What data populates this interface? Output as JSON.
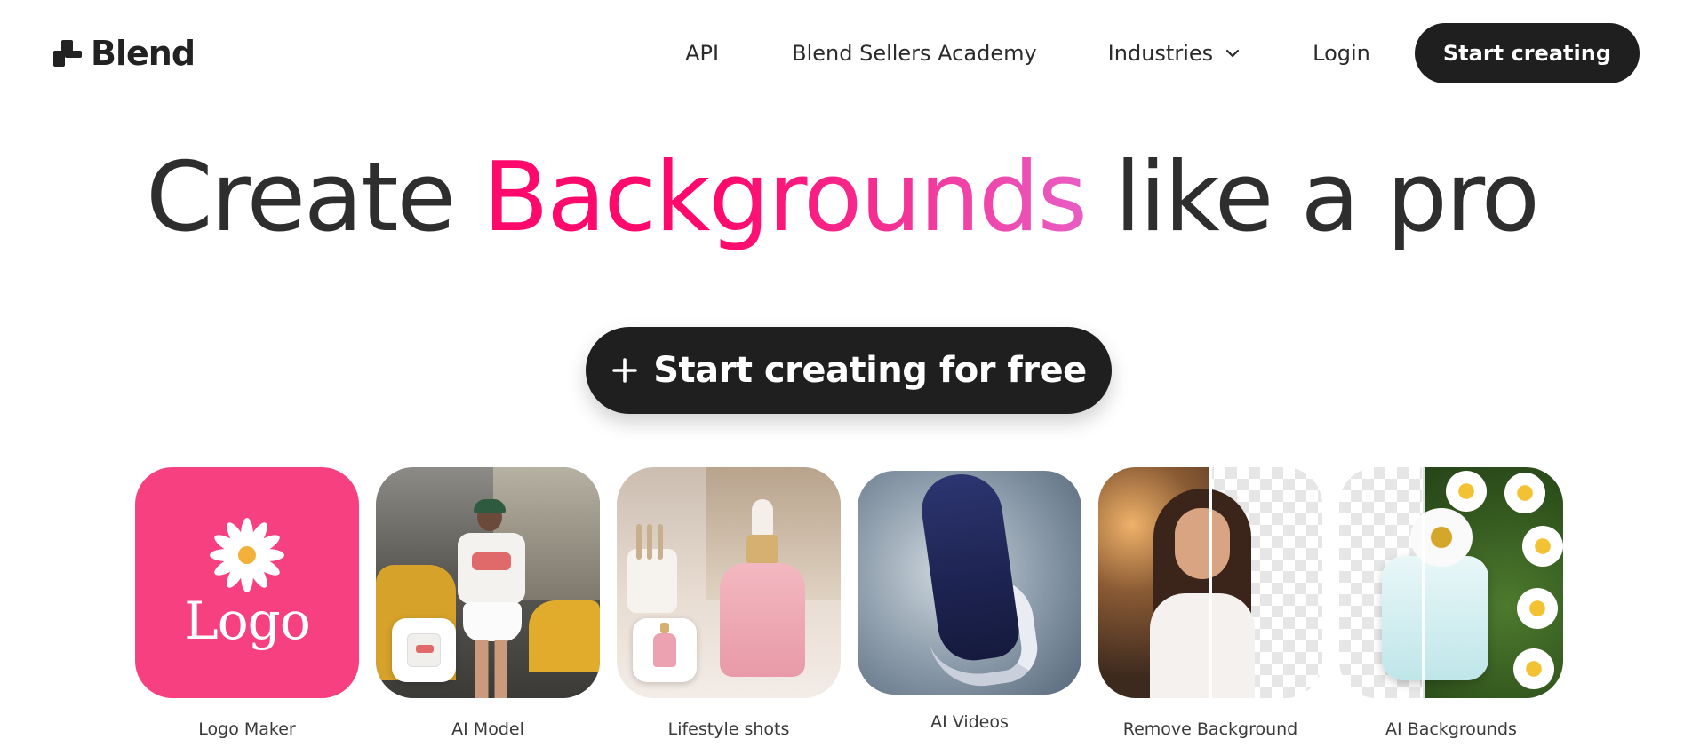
{
  "nav": {
    "logo_text": "Blend",
    "links": {
      "api": "API",
      "academy": "Blend Sellers Academy",
      "industries": "Industries",
      "login": "Login"
    },
    "cta": "Start creating"
  },
  "hero": {
    "title_pre": "Create ",
    "title_highlight": "Backgrounds",
    "title_post": " like a pro",
    "cta_label": "Start creating for free"
  },
  "tools": [
    {
      "label": "Logo Maker",
      "thumb_text": "Logo"
    },
    {
      "label": "AI Model"
    },
    {
      "label": "Lifestyle shots"
    },
    {
      "label": "AI Videos"
    },
    {
      "label": "Remove Background"
    },
    {
      "label": "AI Backgrounds"
    }
  ],
  "colors": {
    "brand_dark": "#1f1f1f",
    "highlight_start": "#ff0a6c",
    "highlight_end": "#e85ec4",
    "logo_tile": "#f7407f"
  }
}
